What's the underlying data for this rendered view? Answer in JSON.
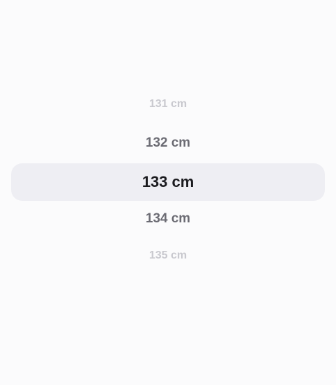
{
  "height_picker": {
    "items": [
      {
        "label": "131 cm",
        "state": "faded"
      },
      {
        "label": "132 cm",
        "state": "near"
      },
      {
        "label": "133 cm",
        "state": "selected"
      },
      {
        "label": "134 cm",
        "state": "near"
      },
      {
        "label": "135 cm",
        "state": "faded"
      }
    ],
    "selected_label": "133 cm",
    "colors": {
      "background": "#fbfbfc",
      "selection_band": "#eeeef3",
      "selected_text": "#1b1b1f",
      "near_text": "#6b6b73",
      "faded_text": "#c9c9cf"
    }
  }
}
